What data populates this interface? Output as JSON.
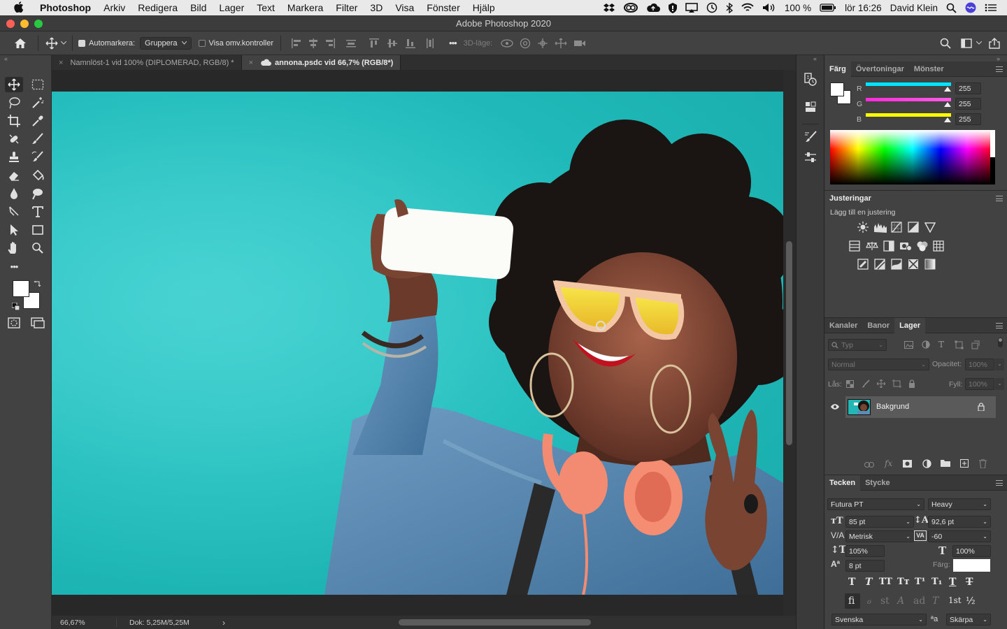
{
  "menubar": {
    "apple": "",
    "app": "Photoshop",
    "items": [
      "Arkiv",
      "Redigera",
      "Bild",
      "Lager",
      "Text",
      "Markera",
      "Filter",
      "3D",
      "Visa",
      "Fönster",
      "Hjälp"
    ],
    "battery": "100 %",
    "clock": "lör 16:26",
    "user": "David Klein"
  },
  "window": {
    "title": "Adobe Photoshop 2020"
  },
  "options": {
    "autoselect_label": "Automarkera:",
    "autoselect_value": "Gruppera",
    "show_transform_label": "Visa omv.kontroller",
    "more": "•••",
    "mode3d_label": "3D-läge:"
  },
  "tabs": [
    {
      "label": "Namnlöst-1 vid 100% (DIPLOMERAD, RGB/8) *",
      "close": "×"
    },
    {
      "label": "annona.psdc vid 66,7% (RGB/8*)",
      "close": "×"
    }
  ],
  "status": {
    "zoom": "66,67%",
    "doc": "Dok: 5,25M/5,25M",
    "arrow": "›"
  },
  "color_panel": {
    "tabs": [
      "Färg",
      "Övertoningar",
      "Mönster"
    ],
    "channels": [
      {
        "name": "R",
        "value": "255",
        "color": "#00e5ff"
      },
      {
        "name": "G",
        "value": "255",
        "color": "#ff3be0"
      },
      {
        "name": "B",
        "value": "255",
        "color": "#ffff00"
      }
    ]
  },
  "adjust_panel": {
    "title": "Justeringar",
    "subtitle": "Lägg till en justering"
  },
  "layers_panel": {
    "tabs": [
      "Kanaler",
      "Banor",
      "Lager"
    ],
    "filter_placeholder": "Typ",
    "blend_mode": "Normal",
    "opacity_label": "Opacitet:",
    "opacity_value": "100%",
    "lock_label": "Lås:",
    "fill_label": "Fyll:",
    "fill_value": "100%",
    "layers": [
      {
        "name": "Bakgrund"
      }
    ]
  },
  "char_panel": {
    "tabs": [
      "Tecken",
      "Stycke"
    ],
    "font": "Futura PT",
    "style": "Heavy",
    "size": "85 pt",
    "leading": "92,6 pt",
    "kerning": "Metrisk",
    "tracking": "-60",
    "vscale": "105%",
    "hscale": "100%",
    "baseline": "8 pt",
    "color_label": "Färg:",
    "language": "Svenska",
    "antialias": "Skärpa",
    "type_buttons": [
      "T",
      "T",
      "TT",
      "Tт",
      "T¹",
      "T₁",
      "T",
      "T"
    ],
    "ot_buttons": [
      "fi",
      "ℴ",
      "st",
      "A",
      "ad",
      "T",
      "1st",
      "½"
    ]
  }
}
